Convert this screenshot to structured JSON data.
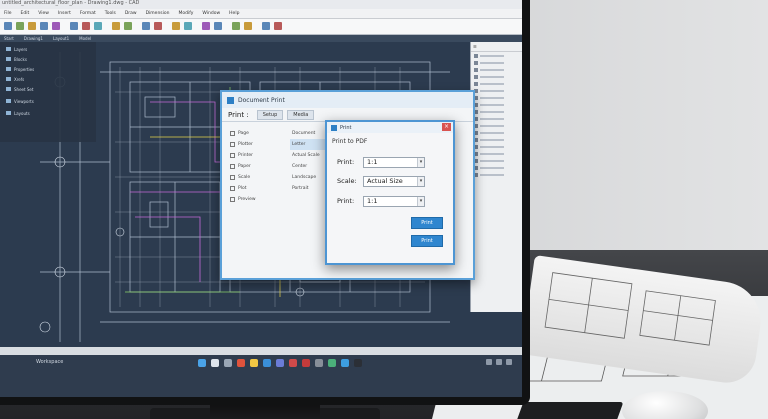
{
  "app": {
    "title": "untitled_architectural_floor_plan - Drawing1.dwg - CAD",
    "menus": [
      "File",
      "Edit",
      "View",
      "Insert",
      "Format",
      "Tools",
      "Draw",
      "Dimension",
      "Modify",
      "Window",
      "Help"
    ],
    "doc_tabs": [
      "Start",
      "Drawing1",
      "Layout1",
      "Model"
    ]
  },
  "sidebar": {
    "items": [
      "Layers",
      "Blocks",
      "Properties",
      "Xrefs",
      "Sheet Set",
      "Viewports",
      "Layouts"
    ]
  },
  "dialog_main": {
    "title": "Document Print",
    "field_label": "Print :",
    "tabs": [
      "Setup",
      "Media"
    ],
    "list_items": [
      "Page",
      "Plotter",
      "Printer",
      "Paper",
      "Scale",
      "Plot",
      "Preview"
    ],
    "values": [
      "Document",
      "Letter",
      "Actual Scale",
      "Center",
      "Landscape",
      "Portrait"
    ]
  },
  "dialog_print": {
    "title": "Print",
    "subtitle": "Print to PDF",
    "fields": [
      {
        "label": "Print:",
        "value": "1:1"
      },
      {
        "label": "Scale:",
        "value": "Actual Size"
      },
      {
        "label": "Print:",
        "value": "1:1"
      }
    ],
    "buttons": [
      "Print",
      "Print"
    ]
  },
  "taskbar": {
    "workspace_label": "Workspace"
  },
  "colors": {
    "screen_bg": "#2c3b4f",
    "accent": "#2f86cf",
    "drawing_line": "#c9d6e6"
  }
}
